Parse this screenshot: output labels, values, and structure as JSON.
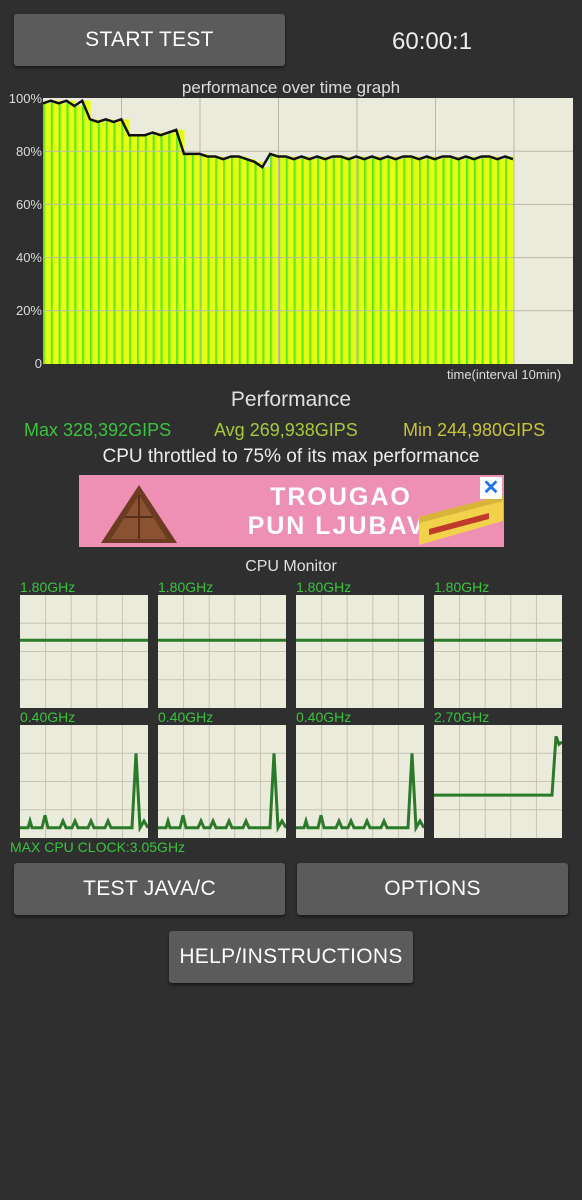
{
  "header": {
    "start_button": "START TEST",
    "timer": "60:00:1"
  },
  "graph": {
    "title": "performance over time graph",
    "y_ticks": [
      "100%",
      "80%",
      "60%",
      "40%",
      "20%",
      "0"
    ],
    "x_label": "time(interval 10min)"
  },
  "chart_data": {
    "type": "line",
    "ylim": [
      0,
      100
    ],
    "xlim": [
      0,
      60
    ],
    "y_unit": "%",
    "x": [
      0,
      1,
      2,
      3,
      4,
      5,
      6,
      7,
      8,
      9,
      10,
      11,
      12,
      13,
      14,
      15,
      16,
      17,
      18,
      19,
      20,
      21,
      22,
      23,
      24,
      25,
      26,
      27,
      28,
      29,
      30,
      31,
      32,
      33,
      34,
      35,
      36,
      37,
      38,
      39,
      40,
      41,
      42,
      43,
      44,
      45,
      46,
      47,
      48,
      49,
      50,
      51,
      52,
      53,
      54,
      55,
      56,
      57,
      58,
      59,
      60
    ],
    "values": [
      98,
      99,
      98,
      99,
      97,
      99,
      92,
      91,
      92,
      91,
      92,
      86,
      86,
      86,
      87,
      86,
      87,
      88,
      79,
      79,
      79,
      78,
      78,
      77,
      78,
      78,
      77,
      76,
      74,
      79,
      78,
      78,
      77,
      78,
      77,
      78,
      77,
      78,
      78,
      77,
      78,
      77,
      78,
      77,
      78,
      77,
      78,
      78,
      77,
      78,
      77,
      78,
      78,
      77,
      78,
      77,
      78,
      78,
      77,
      78,
      77
    ],
    "grid": true
  },
  "performance": {
    "title": "Performance",
    "max": "Max 328,392GIPS",
    "avg": "Avg 269,938GIPS",
    "min": "Min 244,980GIPS",
    "throttle": "CPU throttled to 75% of its max performance"
  },
  "ad": {
    "line1": "TROUGAO",
    "line2": "PUN LJUBAVI",
    "close": "✕"
  },
  "cpu_monitor": {
    "title": "CPU Monitor",
    "cores": [
      {
        "label": "1.80GHz",
        "level": 0.6,
        "spikes": []
      },
      {
        "label": "1.80GHz",
        "level": 0.6,
        "spikes": []
      },
      {
        "label": "1.80GHz",
        "level": 0.6,
        "spikes": []
      },
      {
        "label": "1.80GHz",
        "level": 0.6,
        "spikes": []
      },
      {
        "label": "0.40GHz",
        "level": 0.15,
        "spikes": [
          0.2,
          0.1,
          0.75
        ]
      },
      {
        "label": "0.40GHz",
        "level": 0.15,
        "spikes": [
          0.2,
          0.1,
          0.75
        ]
      },
      {
        "label": "0.40GHz",
        "level": 0.15,
        "spikes": [
          0.2,
          0.1,
          0.75
        ]
      },
      {
        "label": "2.70GHz",
        "level": 0.38,
        "spikes": [
          0.9
        ]
      }
    ],
    "max_clock": "MAX CPU CLOCK:3.05GHz"
  },
  "buttons": {
    "test_java": "TEST JAVA/C",
    "options": "OPTIONS",
    "help": "HELP/INSTRUCTIONS"
  },
  "colors": {
    "accent_green": "#39c43d",
    "avg_color": "#a7c93b",
    "min_color": "#c9c23b",
    "graph_bg": "#ebebdc"
  }
}
